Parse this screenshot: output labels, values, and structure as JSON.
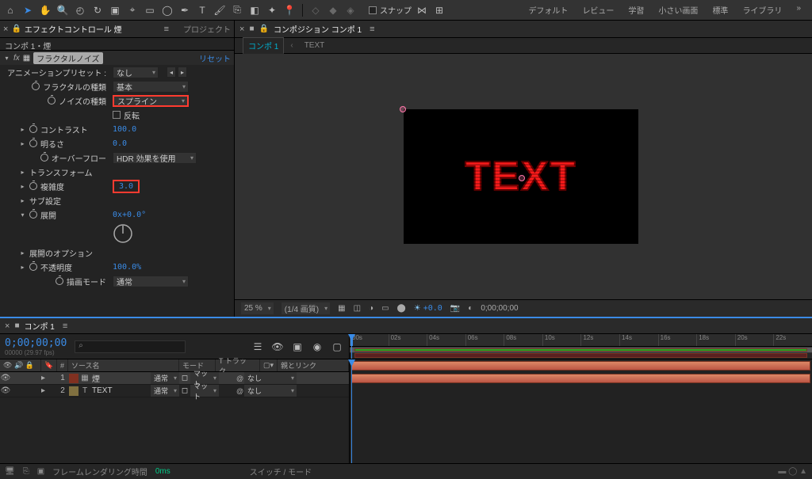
{
  "topbar": {
    "snap_label": "スナップ",
    "workspaces": [
      "デフォルト",
      "レビュー",
      "学習",
      "小さい画面",
      "標準",
      "ライブラリ"
    ]
  },
  "left_panel": {
    "tab_effects": "エフェクトコントロール 煙",
    "tab_project": "プロジェクト",
    "breadcrumb": "コンポ 1・煙",
    "fx_name": "フラクタルノイズ",
    "fx_reset": "リセット",
    "preset_label": "アニメーションプリセット :",
    "preset_val": "なし",
    "props": {
      "fractal_type": {
        "label": "フラクタルの種類",
        "val": "基本"
      },
      "noise_type": {
        "label": "ノイズの種類",
        "val": "スプライン"
      },
      "invert": {
        "label": "反転"
      },
      "contrast": {
        "label": "コントラスト",
        "val": "100.0"
      },
      "brightness": {
        "label": "明るさ",
        "val": "0.0"
      },
      "overflow": {
        "label": "オーバーフロー",
        "val": "HDR 効果を使用"
      },
      "transform": {
        "label": "トランスフォーム"
      },
      "complexity": {
        "label": "複雑度",
        "val": "3.0"
      },
      "sub": {
        "label": "サブ設定"
      },
      "evolution": {
        "label": "展開",
        "val": "0x+0.0°"
      },
      "evo_opts": {
        "label": "展開のオプション"
      },
      "opacity": {
        "label": "不透明度",
        "val": "100.0%"
      },
      "blend": {
        "label": "描画モード",
        "val": "通常"
      }
    }
  },
  "comp_panel": {
    "title": "コンポジション コンポ 1",
    "subtab_comp": "コンポ 1",
    "subtab_text": "TEXT",
    "text_content": "TEXT"
  },
  "viewer_footer": {
    "zoom": "25 %",
    "res": "(1/4 画質)",
    "exposure": "+0.0",
    "time": "0;00;00;00"
  },
  "timeline": {
    "tab": "コンポ 1",
    "timecode": "0;00;00;00",
    "fps": "00000 (29.97 fps)",
    "cols": {
      "src": "ソース名",
      "mode": "モード",
      "track": "T トラック...",
      "parent": "親とリンク"
    },
    "ticks": [
      "00s",
      "02s",
      "04s",
      "06s",
      "08s",
      "10s",
      "12s",
      "14s",
      "16s",
      "18s",
      "20s",
      "22s"
    ],
    "layers": [
      {
        "num": "1",
        "name": "煙",
        "mode": "通常",
        "track": "マット",
        "parent": "なし",
        "color": "#803020",
        "icon": "solid"
      },
      {
        "num": "2",
        "name": "TEXT",
        "mode": "通常",
        "track": "マット",
        "parent": "なし",
        "color": "#807040",
        "icon": "text"
      }
    ],
    "footer": {
      "render": "フレームレンダリング時間",
      "render_ms": "0ms",
      "switches": "スイッチ / モード"
    }
  }
}
